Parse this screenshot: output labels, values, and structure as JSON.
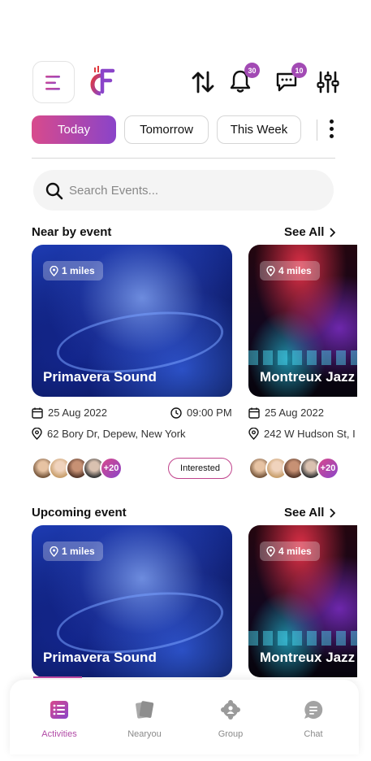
{
  "header": {
    "logo_icon": "cf-logo-icon",
    "icons": [
      "menu-icon",
      "swap-sort-icon",
      "bell-icon",
      "chat-bubble-icon",
      "sliders-icon"
    ],
    "notification_count": "30",
    "message_count": "10"
  },
  "filters": {
    "chips": [
      "Today",
      "Tomorrow",
      "This Week"
    ],
    "active": "Today"
  },
  "search": {
    "placeholder": "Search Events..."
  },
  "nearby": {
    "title": "Near by event",
    "see_all": "See All",
    "cards": [
      {
        "distance": "1 miles",
        "name": "Primavera Sound",
        "date": "25 Aug 2022",
        "time": "09:00 PM",
        "address": "62 Bory Dr, Depew, New York",
        "attendees_more": "+20",
        "action": "Interested"
      },
      {
        "distance": "4 miles",
        "name": "Montreux Jazz",
        "date": "25 Aug 2022",
        "address": "242 W Hudson St, I",
        "attendees_more": "+20"
      }
    ]
  },
  "upcoming": {
    "title": "Upcoming event",
    "see_all": "See All",
    "cards": [
      {
        "distance": "1 miles",
        "name": "Primavera Sound"
      },
      {
        "distance": "4 miles",
        "name": "Montreux Jazz"
      }
    ]
  },
  "bottom_nav": {
    "items": [
      {
        "label": "Activities",
        "icon": "activities-icon",
        "active": true
      },
      {
        "label": "Nearyou",
        "icon": "nearyou-icon",
        "active": false
      },
      {
        "label": "Group",
        "icon": "group-icon",
        "active": false
      },
      {
        "label": "Chat",
        "icon": "chat-icon",
        "active": false
      }
    ]
  },
  "colors": {
    "accent_start": "#d84a8c",
    "accent_end": "#8a44c9",
    "badge": "#a24ab4"
  }
}
